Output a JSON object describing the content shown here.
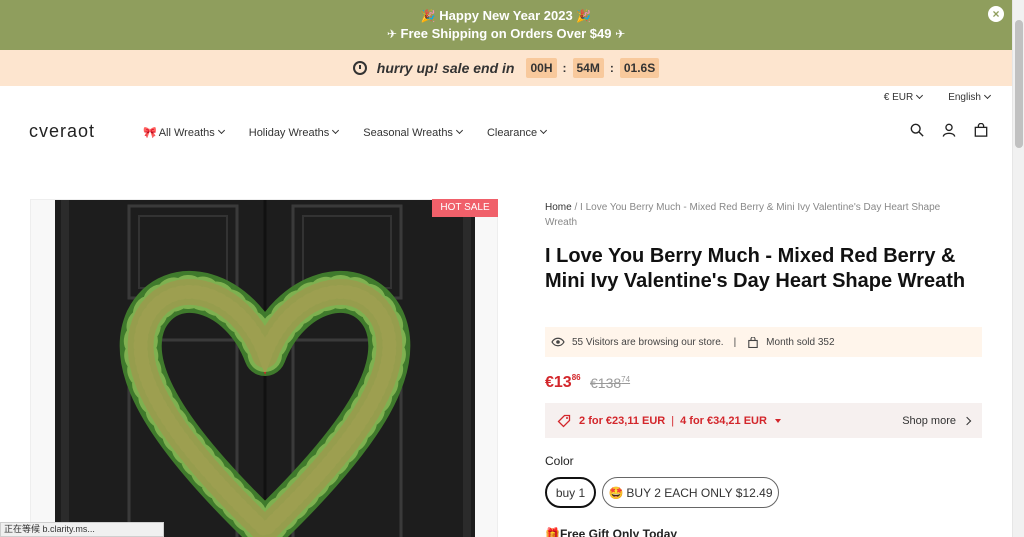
{
  "announcement": {
    "line1": "Happy New Year 2023",
    "line2": "Free Shipping on Orders Over $49",
    "close": "×"
  },
  "countdown": {
    "text": "hurry up! sale end in",
    "hours": "00H",
    "minutes": "54M",
    "seconds": "01.6S",
    "sep": ":"
  },
  "utility": {
    "currency": "€ EUR",
    "language": "English"
  },
  "header": {
    "logo": "cveraot",
    "nav": [
      "All Wreaths",
      "Holiday Wreaths",
      "Seasonal Wreaths",
      "Clearance"
    ]
  },
  "product": {
    "badge": "HOT SALE",
    "breadcrumb_home": "Home",
    "breadcrumb_rest": " / I Love You Berry Much - Mixed Red Berry & Mini Ivy Valentine's Day Heart Shape Wreath",
    "title": "I Love You Berry Much - Mixed Red Berry & Mini Ivy Valentine's Day Heart Shape Wreath",
    "visitors": "55 Visitors are browsing our store.",
    "sold": "Month sold 352",
    "price_main": "€13",
    "price_cents": "86",
    "old_main": "€138",
    "old_cents": "74",
    "bundle1_qty": "2",
    "bundle1_text": "for €23,11 EUR",
    "bundle2_qty": "4",
    "bundle2_text": "for €34,21 EUR",
    "shop_more": "Shop more",
    "color_label": "Color",
    "options": [
      "buy 1",
      "BUY 2 EACH ONLY $12.49"
    ],
    "gift": "Free Gift Only Today"
  },
  "statusbar": "正在等候 b.clarity.ms...",
  "colors": {
    "announce": "#8f9e5d",
    "countdown_bg": "#fde5cf",
    "price": "#d3262b",
    "badge": "#f0606a"
  }
}
